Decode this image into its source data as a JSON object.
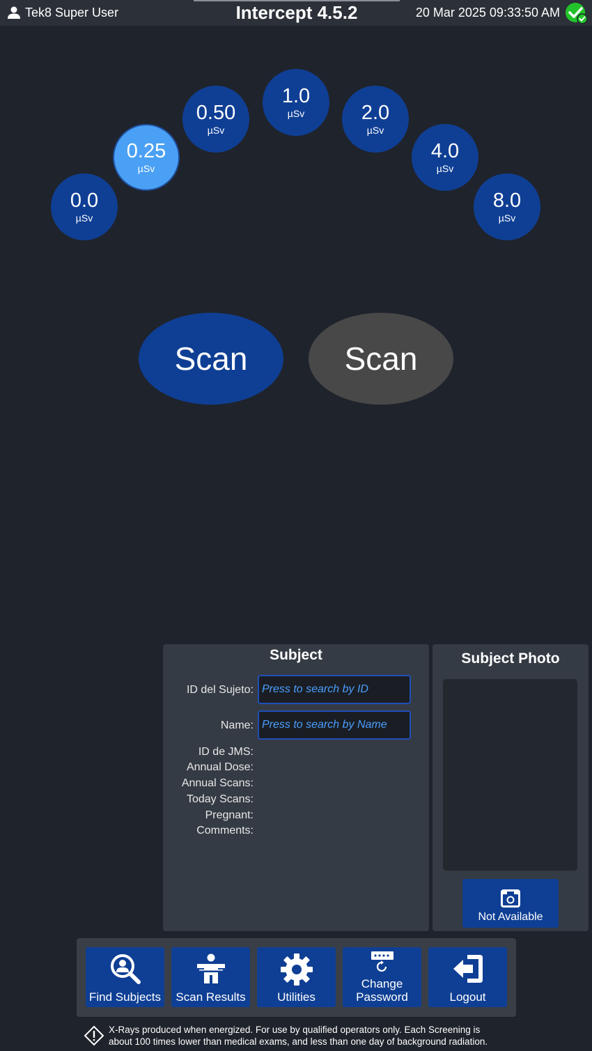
{
  "header": {
    "user_name": "Tek8 Super User",
    "app_title": "Intercept 4.5.2",
    "datetime": "20 Mar 2025 09:33:50 AM",
    "status_color": "#22c32a"
  },
  "dose_options": {
    "unit": "µSv",
    "items": [
      {
        "value": "0.0"
      },
      {
        "value": "0.25",
        "selected": true
      },
      {
        "value": "0.50"
      },
      {
        "value": "1.0"
      },
      {
        "value": "2.0"
      },
      {
        "value": "4.0"
      },
      {
        "value": "8.0"
      }
    ]
  },
  "scan": {
    "left_label": "Scan",
    "right_label": "Scan"
  },
  "subject": {
    "title": "Subject",
    "id_label": "ID del Sujeto:",
    "id_placeholder": "Press to search by ID",
    "name_label": "Name:",
    "name_placeholder": "Press to search by Name",
    "jms_label": "ID de JMS:",
    "annual_dose_label": "Annual Dose:",
    "annual_scans_label": "Annual Scans:",
    "today_scans_label": "Today Scans:",
    "pregnant_label": "Pregnant:",
    "comments_label": "Comments:"
  },
  "photo": {
    "title": "Subject Photo",
    "button_label": "Not Available"
  },
  "toolbar": {
    "find_subjects": "Find Subjects",
    "scan_results": "Scan Results",
    "utilities": "Utilities",
    "change_password_1": "Change",
    "change_password_2": "Password",
    "logout": "Logout"
  },
  "footer": {
    "warning_line1": "X-Rays produced when energized. For use by qualified operators only. Each Screening is",
    "warning_line2": "about 100 times lower than medical exams, and less than one day of background radiation."
  },
  "colors": {
    "accent": "#0f3f94",
    "selected": "#4aa0f4",
    "background": "#1f232b",
    "panel": "#353b44",
    "link": "#4a9eff"
  }
}
